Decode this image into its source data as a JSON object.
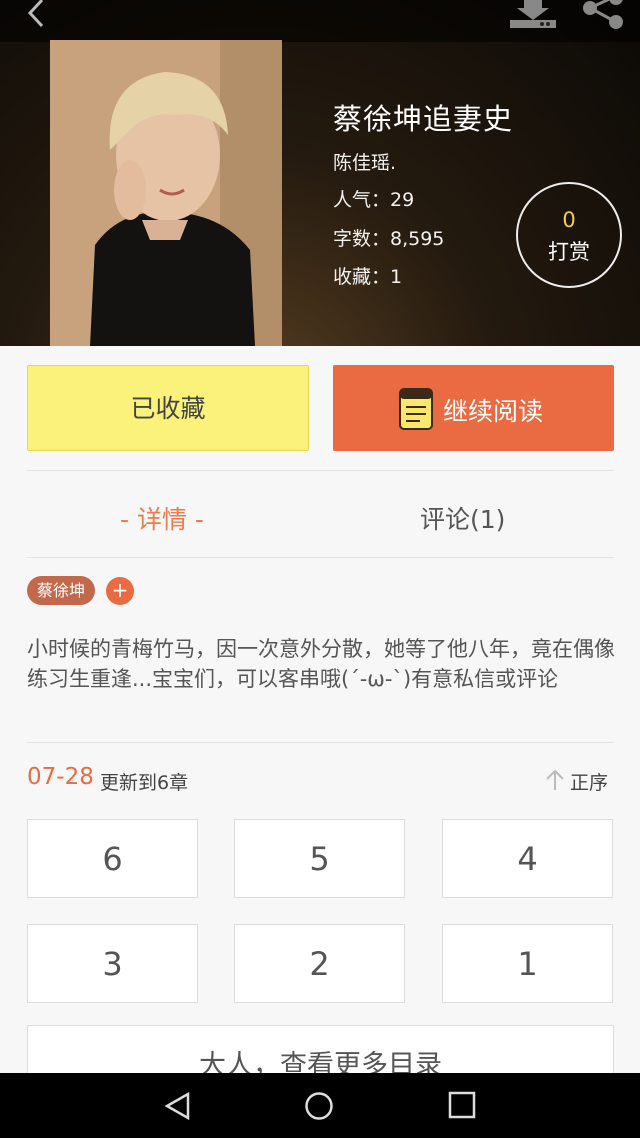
{
  "book": {
    "title": "蔡徐坤追妻史",
    "author": "陈佳瑶.",
    "popularity": "人气：29",
    "word_count": "字数：8,595",
    "favorites": "收藏：1"
  },
  "tip": {
    "count": "0",
    "label": "打赏"
  },
  "actions": {
    "favorited_label": "已收藏",
    "continue_label": "继续阅读"
  },
  "tabs": {
    "detail": "- 详情 -",
    "comments": "评论(1)"
  },
  "tags": [
    "蔡徐坤"
  ],
  "tag_add": "+",
  "description": "小时候的青梅竹马，因一次意外分散，她等了他八年，竟在偶像练习生重逢...宝宝们，可以客串哦(´-ω-`)有意私信或评论",
  "update": {
    "date": "07-28",
    "text": "更新到6章"
  },
  "sort_label": "正序",
  "chapters": [
    "6",
    "5",
    "4",
    "3",
    "2",
    "1"
  ],
  "more_label": "大人，查看更多目录",
  "colors": {
    "accent": "#ea6b42",
    "favorite_bg": "#fbf27c",
    "tip_count": "#f5cd4a"
  }
}
